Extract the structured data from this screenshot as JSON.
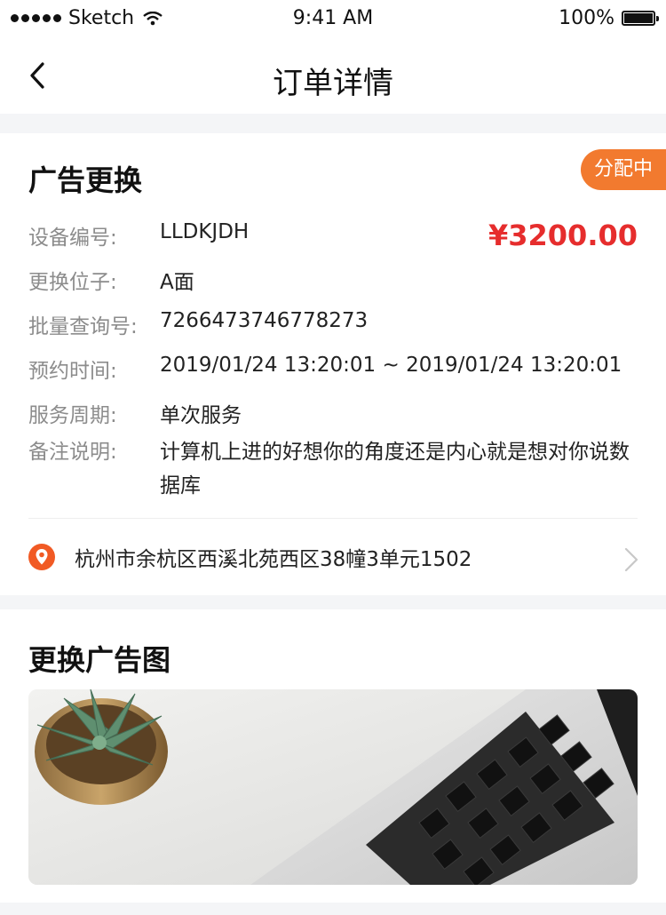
{
  "status_bar": {
    "carrier": "Sketch",
    "time": "9:41 AM",
    "battery": "100%"
  },
  "nav": {
    "title": "订单详情"
  },
  "order": {
    "title": "广告更换",
    "status_badge": "分配中",
    "price": "¥3200.00",
    "fields": [
      {
        "label": "设备编号:",
        "value": "LLDKJDH"
      },
      {
        "label": "更换位子:",
        "value": "A面"
      },
      {
        "label": "批量查询号:",
        "value": "7266473746778273"
      },
      {
        "label": "预约时间:",
        "value": "2019/01/24 13:20:01 ~ 2019/01/24 13:20:01"
      },
      {
        "label": "服务周期:",
        "value": "单次服务"
      },
      {
        "label": "备注说明:",
        "value": "计算机上进的好想你的角度还是内心就是想对你说数据库"
      }
    ],
    "address": "杭州市余杭区西溪北苑西区38幢3单元1502"
  },
  "ad_image_section": {
    "title": "更换广告图"
  },
  "colors": {
    "accent": "#f27a2f",
    "price": "#e62d2d",
    "pin": "#f15a24"
  },
  "icons": {
    "back": "chevron-left-icon",
    "location": "location-pin-icon",
    "arrow": "chevron-right-icon"
  }
}
